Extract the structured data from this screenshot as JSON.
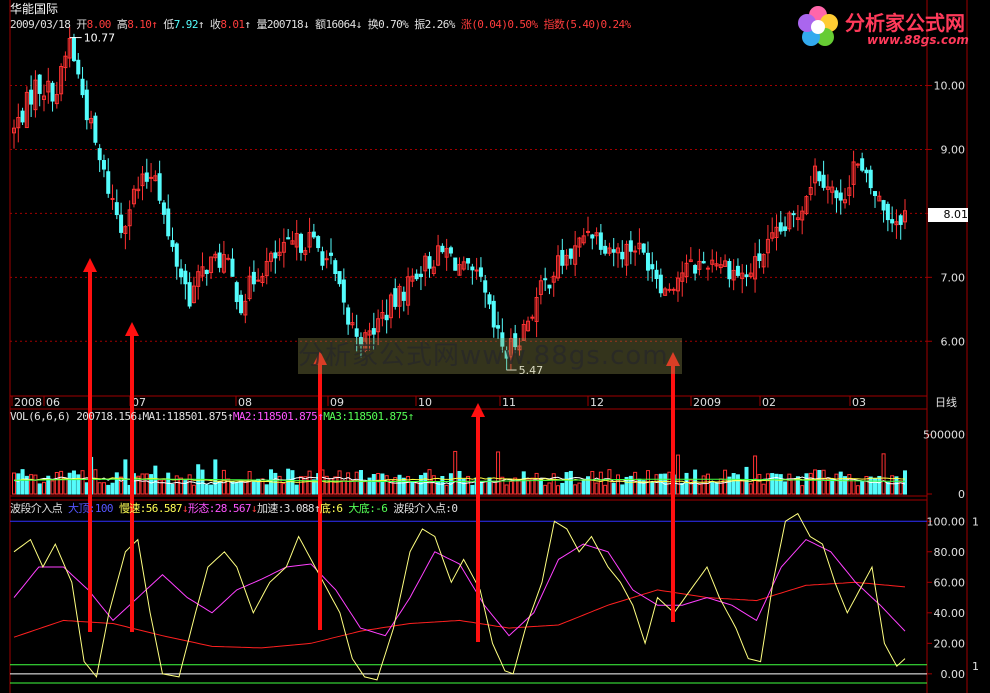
{
  "stock_name": "华能国际",
  "quote": {
    "date": "2009/03/18",
    "open_label": "开",
    "open": "8.00",
    "high_label": "高",
    "high": "8.10",
    "low_label": "低",
    "low": "7.92",
    "close_label": "收",
    "close": "8.01",
    "vol_label": "量",
    "vol": "200718",
    "amount_label": "额",
    "amount": "16064",
    "turnover_label": "换",
    "turnover": "0.70%",
    "amplitude_label": "振",
    "amplitude": "2.26%",
    "change_label": "涨",
    "change": "(0.04)",
    "change_pct": "0.50%",
    "index_label": "指数",
    "index_change": "(5.40)",
    "index_pct": "0.24%"
  },
  "logo": {
    "text": "分析家公式网",
    "url": "www.88gs.com"
  },
  "watermark": "分析家公式网www.88gs.com",
  "period_label": "日线",
  "current_price_tag": "8.01",
  "price_annotations": {
    "high": "10.77",
    "low": "5.47"
  },
  "vol_panel": {
    "title": "VOL(6,6,6)",
    "vol": "200718.156",
    "ma1_label": "MA1:",
    "ma1": "118501.875",
    "ma2_label": "MA2:",
    "ma2": "118501.875",
    "ma3_label": "MA3:",
    "ma3": "118501.875",
    "axis": [
      "500000",
      "0"
    ]
  },
  "osc_panel": {
    "title": "波段介入点",
    "l1": "大顶:100",
    "l2": "慢速:56.587",
    "l3": "形态:28.567",
    "l4": "加速:3.088",
    "l5": "底:6",
    "l6": "大底:-6",
    "signal": "波段介入点:0",
    "axis": [
      "100.00",
      "80.00",
      "60.00",
      "40.00",
      "20.00",
      "0.00"
    ],
    "right_markers": [
      "1",
      "1"
    ]
  },
  "price_axis": [
    "10.00",
    "9.00",
    "8.00",
    "7.00",
    "6.00"
  ],
  "date_axis": [
    "2008",
    "06",
    "07",
    "08",
    "09",
    "10",
    "11",
    "12",
    "2009",
    "02",
    "03"
  ],
  "colors": {
    "up": "#ff3232",
    "down": "#54fcfc",
    "grid": "#a00000",
    "fast": "#ffff80",
    "slow": "#ff40ff",
    "trend": "#ff2020",
    "arrow": "#ff1010"
  },
  "chart_data": [
    {
      "type": "candlestick",
      "title": "华能国际",
      "x_range": [
        "2008",
        "2009/03/18"
      ],
      "ylim": [
        5.3,
        10.9
      ],
      "ticks_y": [
        6,
        7,
        8,
        9,
        10
      ],
      "x_ticks": [
        "2008",
        "06",
        "07",
        "08",
        "09",
        "10",
        "11",
        "12",
        "2009",
        "02",
        "03"
      ],
      "annotations": [
        {
          "label": "10.77",
          "x": "2008-05"
        },
        {
          "label": "5.47",
          "x": "2008-10"
        }
      ],
      "close_anchors": [
        {
          "x": 0,
          "y": 9.3
        },
        {
          "x": 5,
          "y": 10.0
        },
        {
          "x": 10,
          "y": 9.9
        },
        {
          "x": 13,
          "y": 10.7
        },
        {
          "x": 17,
          "y": 9.6
        },
        {
          "x": 20,
          "y": 8.8
        },
        {
          "x": 25,
          "y": 7.8
        },
        {
          "x": 28,
          "y": 8.3
        },
        {
          "x": 33,
          "y": 8.7
        },
        {
          "x": 36,
          "y": 7.6
        },
        {
          "x": 41,
          "y": 6.7
        },
        {
          "x": 45,
          "y": 7.2
        },
        {
          "x": 49,
          "y": 7.3
        },
        {
          "x": 53,
          "y": 6.6
        },
        {
          "x": 57,
          "y": 7.1
        },
        {
          "x": 61,
          "y": 7.3
        },
        {
          "x": 65,
          "y": 7.5
        },
        {
          "x": 69,
          "y": 7.6
        },
        {
          "x": 74,
          "y": 7.2
        },
        {
          "x": 78,
          "y": 6.3
        },
        {
          "x": 82,
          "y": 6.0
        },
        {
          "x": 86,
          "y": 6.4
        },
        {
          "x": 90,
          "y": 6.7
        },
        {
          "x": 94,
          "y": 7.1
        },
        {
          "x": 98,
          "y": 7.3
        },
        {
          "x": 101,
          "y": 7.4
        },
        {
          "x": 105,
          "y": 7.1
        },
        {
          "x": 109,
          "y": 6.9
        },
        {
          "x": 112,
          "y": 6.2
        },
        {
          "x": 115,
          "y": 5.8
        },
        {
          "x": 119,
          "y": 6.2
        },
        {
          "x": 123,
          "y": 6.8
        },
        {
          "x": 127,
          "y": 7.2
        },
        {
          "x": 131,
          "y": 7.4
        },
        {
          "x": 134,
          "y": 7.8
        },
        {
          "x": 137,
          "y": 7.6
        },
        {
          "x": 141,
          "y": 7.4
        },
        {
          "x": 145,
          "y": 7.5
        },
        {
          "x": 149,
          "y": 7.2
        },
        {
          "x": 152,
          "y": 6.8
        },
        {
          "x": 156,
          "y": 7.1
        },
        {
          "x": 160,
          "y": 7.2
        },
        {
          "x": 164,
          "y": 7.3
        },
        {
          "x": 168,
          "y": 7.1
        },
        {
          "x": 171,
          "y": 7.0
        },
        {
          "x": 175,
          "y": 7.4
        },
        {
          "x": 179,
          "y": 7.7
        },
        {
          "x": 183,
          "y": 8.0
        },
        {
          "x": 187,
          "y": 8.7
        },
        {
          "x": 190,
          "y": 8.5
        },
        {
          "x": 193,
          "y": 8.1
        },
        {
          "x": 196,
          "y": 8.8
        },
        {
          "x": 199,
          "y": 8.5
        },
        {
          "x": 202,
          "y": 8.2
        },
        {
          "x": 205,
          "y": 7.9
        },
        {
          "x": 208,
          "y": 8.01
        }
      ]
    },
    {
      "type": "bar",
      "title": "VOL(6,6,6)",
      "ylim": [
        0,
        700000
      ],
      "ticks_y": [
        0,
        500000
      ],
      "ma_values": {
        "MA1": 118501.875,
        "MA2": 118501.875,
        "MA3": 118501.875
      },
      "last_volume": 200718.156
    },
    {
      "type": "line",
      "title": "波段介入点",
      "ylim": [
        -6,
        110
      ],
      "ticks_y": [
        0,
        20,
        40,
        60,
        80,
        100
      ],
      "series": [
        {
          "name": "大顶",
          "values": [
            100
          ]
        },
        {
          "name": "慢速",
          "values": [
            56.587
          ]
        },
        {
          "name": "形态",
          "values": [
            28.567
          ]
        },
        {
          "name": "加速",
          "values": [
            3.088
          ]
        },
        {
          "name": "底",
          "values": [
            6
          ]
        },
        {
          "name": "大底",
          "values": [
            -6
          ]
        },
        {
          "name": "波段介入点",
          "values": [
            0
          ]
        }
      ],
      "fast_anchors": [
        [
          0,
          80
        ],
        [
          4,
          88
        ],
        [
          7,
          70
        ],
        [
          10,
          85
        ],
        [
          14,
          60
        ],
        [
          17,
          8
        ],
        [
          20,
          -2
        ],
        [
          23,
          40
        ],
        [
          27,
          80
        ],
        [
          30,
          88
        ],
        [
          33,
          40
        ],
        [
          36,
          0
        ],
        [
          40,
          -2
        ],
        [
          44,
          40
        ],
        [
          47,
          70
        ],
        [
          51,
          80
        ],
        [
          54,
          70
        ],
        [
          58,
          40
        ],
        [
          62,
          60
        ],
        [
          66,
          70
        ],
        [
          69,
          90
        ],
        [
          72,
          75
        ],
        [
          75,
          60
        ],
        [
          79,
          40
        ],
        [
          82,
          10
        ],
        [
          85,
          -2
        ],
        [
          88,
          -4
        ],
        [
          92,
          30
        ],
        [
          96,
          80
        ],
        [
          99,
          95
        ],
        [
          102,
          90
        ],
        [
          106,
          60
        ],
        [
          109,
          75
        ],
        [
          113,
          55
        ],
        [
          116,
          20
        ],
        [
          119,
          2
        ],
        [
          121,
          0
        ],
        [
          124,
          30
        ],
        [
          128,
          60
        ],
        [
          131,
          100
        ],
        [
          134,
          95
        ],
        [
          137,
          80
        ],
        [
          140,
          90
        ],
        [
          144,
          70
        ],
        [
          147,
          60
        ],
        [
          150,
          45
        ],
        [
          153,
          20
        ],
        [
          156,
          50
        ],
        [
          160,
          40
        ],
        [
          164,
          55
        ],
        [
          168,
          70
        ],
        [
          171,
          50
        ],
        [
          175,
          30
        ],
        [
          178,
          10
        ],
        [
          181,
          8
        ],
        [
          184,
          60
        ],
        [
          187,
          100
        ],
        [
          190,
          105
        ],
        [
          193,
          90
        ],
        [
          196,
          85
        ],
        [
          199,
          60
        ],
        [
          202,
          40
        ],
        [
          205,
          55
        ],
        [
          208,
          70
        ],
        [
          211,
          20
        ],
        [
          214,
          5
        ],
        [
          216,
          10
        ]
      ],
      "slow_anchors": [
        [
          0,
          50
        ],
        [
          6,
          70
        ],
        [
          12,
          70
        ],
        [
          18,
          55
        ],
        [
          24,
          35
        ],
        [
          30,
          50
        ],
        [
          36,
          65
        ],
        [
          42,
          50
        ],
        [
          48,
          40
        ],
        [
          54,
          55
        ],
        [
          60,
          62
        ],
        [
          66,
          70
        ],
        [
          72,
          72
        ],
        [
          78,
          55
        ],
        [
          84,
          30
        ],
        [
          90,
          25
        ],
        [
          96,
          50
        ],
        [
          102,
          80
        ],
        [
          108,
          72
        ],
        [
          114,
          45
        ],
        [
          120,
          25
        ],
        [
          126,
          40
        ],
        [
          132,
          75
        ],
        [
          138,
          85
        ],
        [
          144,
          80
        ],
        [
          150,
          55
        ],
        [
          156,
          45
        ],
        [
          162,
          45
        ],
        [
          168,
          50
        ],
        [
          174,
          45
        ],
        [
          180,
          35
        ],
        [
          186,
          70
        ],
        [
          192,
          88
        ],
        [
          198,
          80
        ],
        [
          204,
          60
        ],
        [
          210,
          45
        ],
        [
          216,
          28
        ]
      ],
      "trend_anchors": [
        [
          0,
          24
        ],
        [
          12,
          35
        ],
        [
          24,
          33
        ],
        [
          36,
          25
        ],
        [
          48,
          18
        ],
        [
          60,
          17
        ],
        [
          72,
          20
        ],
        [
          84,
          28
        ],
        [
          96,
          33
        ],
        [
          108,
          35
        ],
        [
          120,
          30
        ],
        [
          132,
          32
        ],
        [
          144,
          45
        ],
        [
          156,
          55
        ],
        [
          168,
          50
        ],
        [
          180,
          48
        ],
        [
          192,
          58
        ],
        [
          204,
          60
        ],
        [
          216,
          57
        ]
      ]
    }
  ]
}
